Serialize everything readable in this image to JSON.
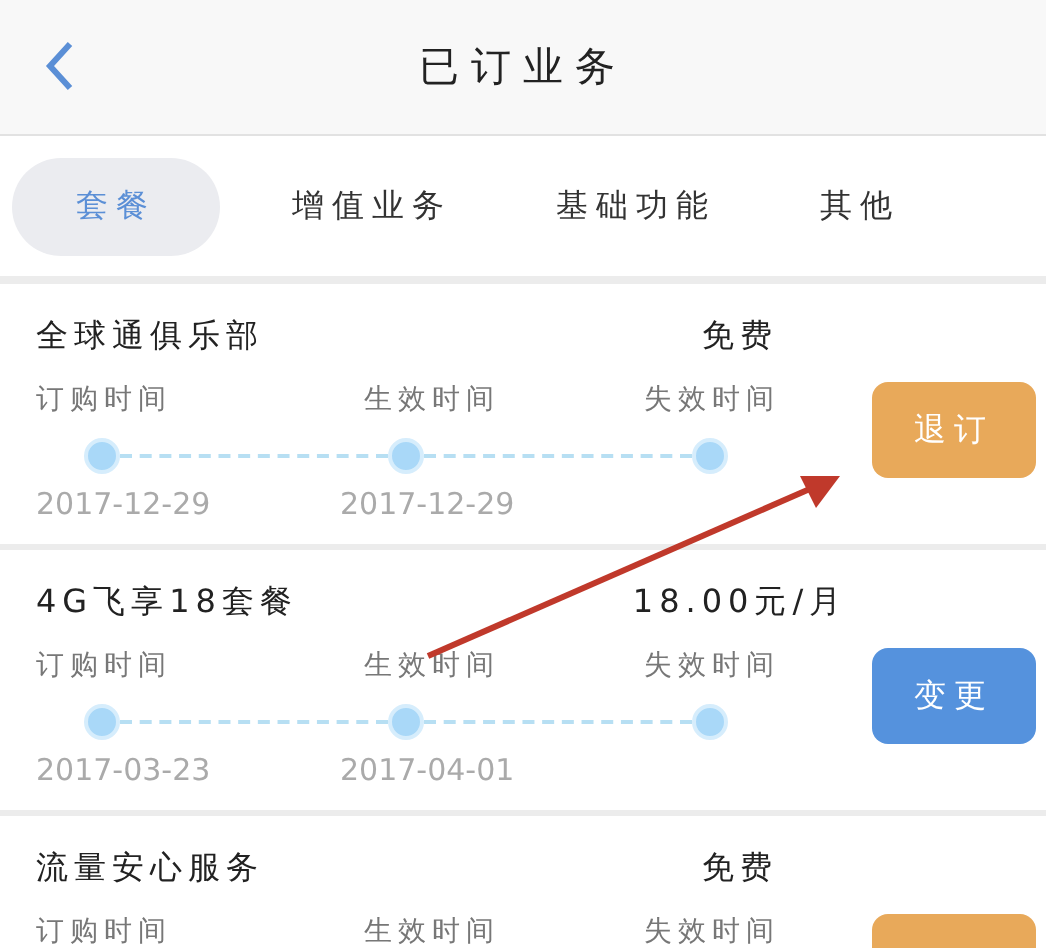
{
  "header": {
    "title": "已订业务"
  },
  "tabs": [
    {
      "label": "套餐",
      "selected": true
    },
    {
      "label": "增值业务",
      "selected": false
    },
    {
      "label": "基础功能",
      "selected": false
    },
    {
      "label": "其他",
      "selected": false
    }
  ],
  "services": [
    {
      "name": "全球通俱乐部",
      "price": "免费",
      "milestones": [
        {
          "label": "订购时间",
          "date": "2017-12-29"
        },
        {
          "label": "生效时间",
          "date": "2017-12-29"
        },
        {
          "label": "失效时间"
        }
      ],
      "button": {
        "kind": "cancel",
        "label": "退订"
      }
    },
    {
      "name": "4G飞享18套餐",
      "price": "18.00元/月",
      "milestones": [
        {
          "label": "订购时间",
          "date": "2017-03-23"
        },
        {
          "label": "生效时间",
          "date": "2017-04-01"
        },
        {
          "label": "失效时间"
        }
      ],
      "button": {
        "kind": "change",
        "label": "变更"
      }
    },
    {
      "name": "流量安心服务",
      "price": "免费",
      "milestones": [
        {
          "label": "订购时间"
        },
        {
          "label": "生效时间"
        },
        {
          "label": "失效时间"
        }
      ],
      "cut_off": true,
      "button": {
        "kind": "cancel"
      }
    }
  ]
}
